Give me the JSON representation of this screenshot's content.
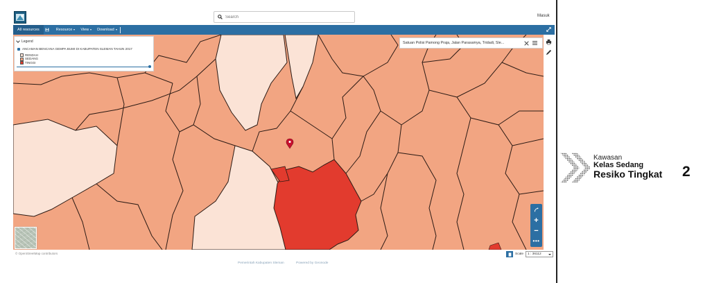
{
  "header": {
    "search_placeholder": "Search",
    "login_label": "Masuk"
  },
  "nav": {
    "all_resources": "All resources",
    "resource": "Resource",
    "view": "View",
    "download": "Download"
  },
  "legend": {
    "title": "Legend",
    "layer_name": "ANCAMAN BENCANA GEMPA BUMI DI KABUPATEN SLEMAN TAHUN 2017",
    "items": [
      {
        "label": "RENDAH",
        "color": "#fbe3d6"
      },
      {
        "label": "SEDANG",
        "color": "#f2a582"
      },
      {
        "label": "TINGGI",
        "color": "#e23b2e"
      }
    ],
    "opacity": 1.0
  },
  "info_panel": {
    "text": "Satuan Polisi Pamong Praja, Jalan Parasamya, Tridadi, Sle..."
  },
  "map": {
    "colors": {
      "low": "#fbe3d6",
      "medium": "#f2a582",
      "high": "#e23b2e",
      "border": "#2b1a14"
    }
  },
  "footer": {
    "attribution": "© OpenStreetMap contributors",
    "scale_label": "Scale",
    "scale_value": "1 : 36112",
    "left_link": "Pemerintah Kabupaten Sleman",
    "right_link": "Powered by Geonode"
  },
  "banner": {
    "line1": "Kawasan",
    "line2": "Kelas Sedang",
    "line3": "Resiko Tingkat",
    "number": "2"
  },
  "colors": {
    "nav": "#2c6fa3",
    "accent": "#2c6fa3"
  }
}
